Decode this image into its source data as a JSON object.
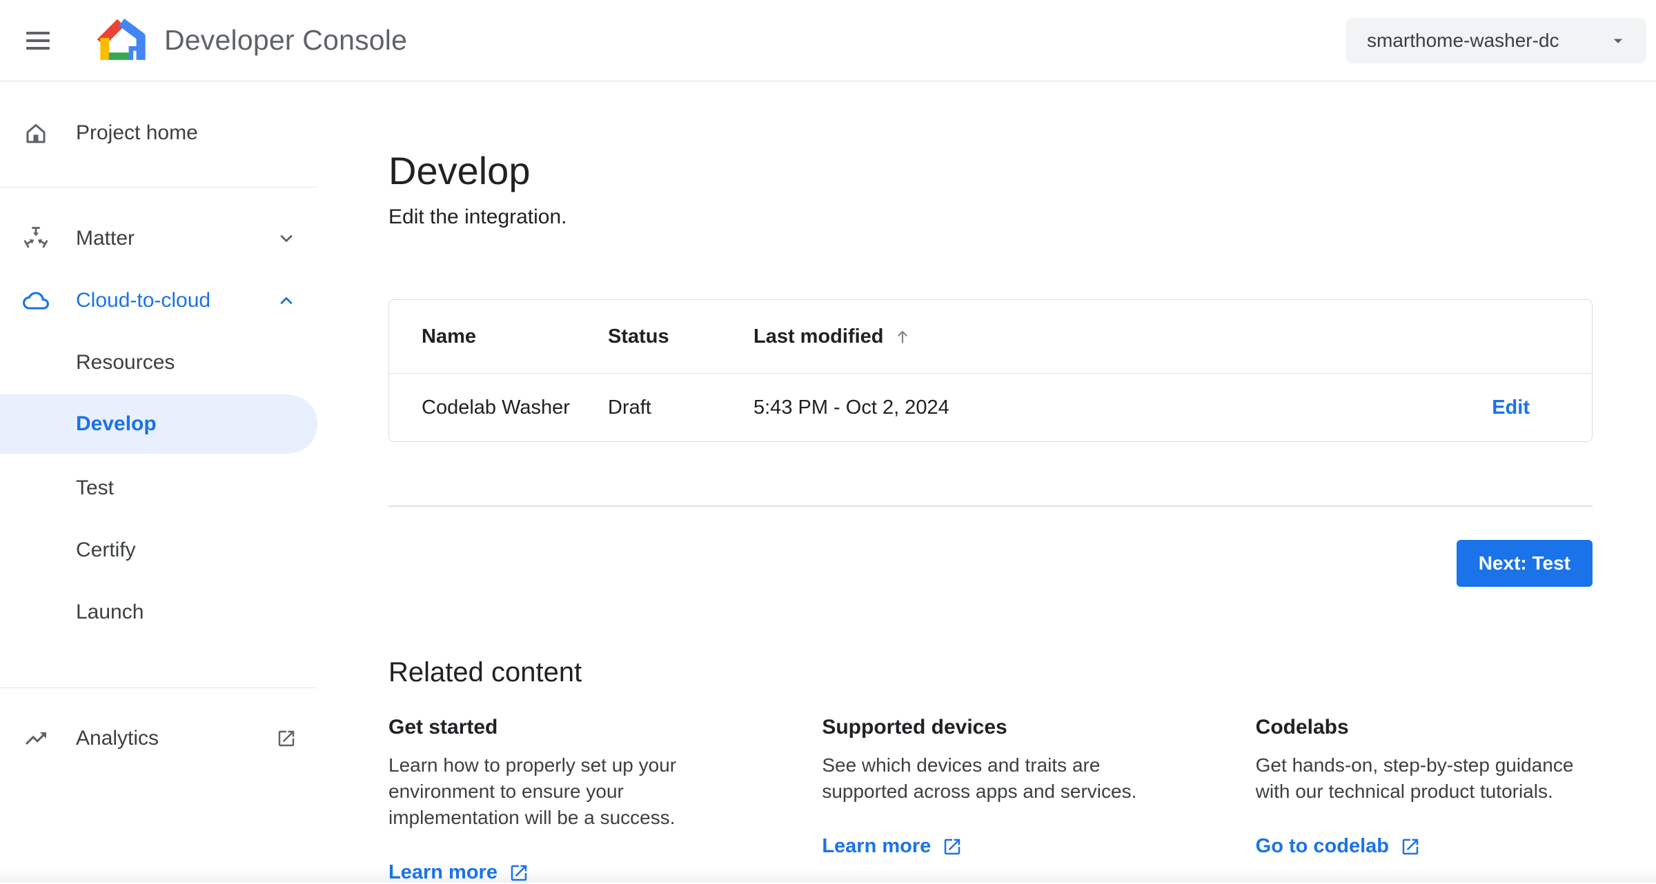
{
  "header": {
    "title": "Developer Console",
    "project_selector": {
      "value": "smarthome-washer-dc"
    }
  },
  "sidebar": {
    "items": [
      {
        "label": "Project home",
        "icon": "home-icon"
      },
      {
        "label": "Matter",
        "icon": "matter-icon",
        "chevron": "chevron-down-icon"
      },
      {
        "label": "Cloud-to-cloud",
        "icon": "cloud-icon",
        "chevron": "chevron-up-icon",
        "expanded": true
      },
      {
        "label": "Resources"
      },
      {
        "label": "Develop",
        "selected": true
      },
      {
        "label": "Test"
      },
      {
        "label": "Certify"
      },
      {
        "label": "Launch"
      },
      {
        "label": "Analytics",
        "icon": "trending-up-icon",
        "external_icon": "open-in-new-icon"
      }
    ]
  },
  "main": {
    "title": "Develop",
    "subtitle": "Edit the integration.",
    "table": {
      "columns": [
        "Name",
        "Status",
        "Last modified"
      ],
      "sort_column": "Last modified",
      "sort_direction": "ascending",
      "rows": [
        {
          "name": "Codelab Washer",
          "status": "Draft",
          "last_modified": "5:43 PM - Oct 2, 2024",
          "action": "Edit"
        }
      ]
    },
    "next_button": "Next: Test"
  },
  "related": {
    "title": "Related content",
    "cards": [
      {
        "heading": "Get started",
        "body": "Learn how to properly set up your environment to ensure your implementation will be a success.",
        "link": "Learn more"
      },
      {
        "heading": "Supported devices",
        "body": "See which devices and traits are supported across apps and services.",
        "link": "Learn more"
      },
      {
        "heading": "Codelabs",
        "body": "Get hands-on, step-by-step guidance with our technical product tutorials.",
        "link": "Go to codelab"
      }
    ]
  },
  "colors": {
    "accent": "#1a73e8",
    "selected_item_bg": "#e8f0fe",
    "header_text": "#5f6368",
    "body_text": "#3c4043",
    "heading_text": "#202124",
    "border": "#dadce0",
    "chip_bg": "#f1f3f4",
    "logo_red": "#ea4335",
    "logo_blue": "#4285f4",
    "logo_yellow": "#fbbc04",
    "logo_green": "#34a853"
  }
}
